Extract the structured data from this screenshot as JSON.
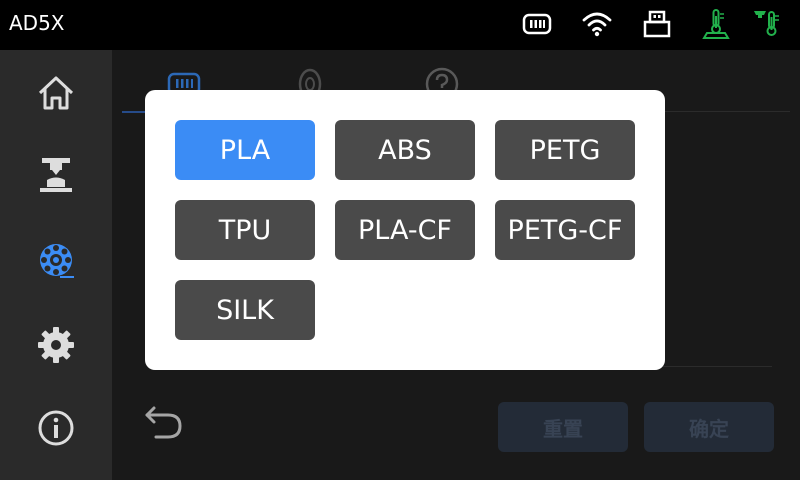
{
  "header": {
    "device_name": "AD5X",
    "icons": [
      "filament-slot-icon",
      "wifi-icon",
      "usb-drive-icon",
      "nozzle-temperature-icon",
      "bed-temperature-icon"
    ]
  },
  "sidebar": {
    "items": [
      {
        "name": "home",
        "icon": "home-icon"
      },
      {
        "name": "print",
        "icon": "printer-nozzle-icon"
      },
      {
        "name": "filament",
        "icon": "filament-spool-icon",
        "active": true
      },
      {
        "name": "settings",
        "icon": "gear-icon"
      },
      {
        "name": "info",
        "icon": "info-icon"
      }
    ]
  },
  "main": {
    "tabs": [
      "filament-slots-tab",
      "spool-tab",
      "help-tab"
    ],
    "reset_label": "重置",
    "confirm_label": "确定"
  },
  "material_picker": {
    "options": [
      "PLA",
      "ABS",
      "PETG",
      "TPU",
      "PLA-CF",
      "PETG-CF",
      "SILK"
    ],
    "selected": "PLA"
  },
  "colors": {
    "accent": "#3b8cf5",
    "status_green": "#22b14c",
    "button_gray": "#4a4a4a"
  }
}
